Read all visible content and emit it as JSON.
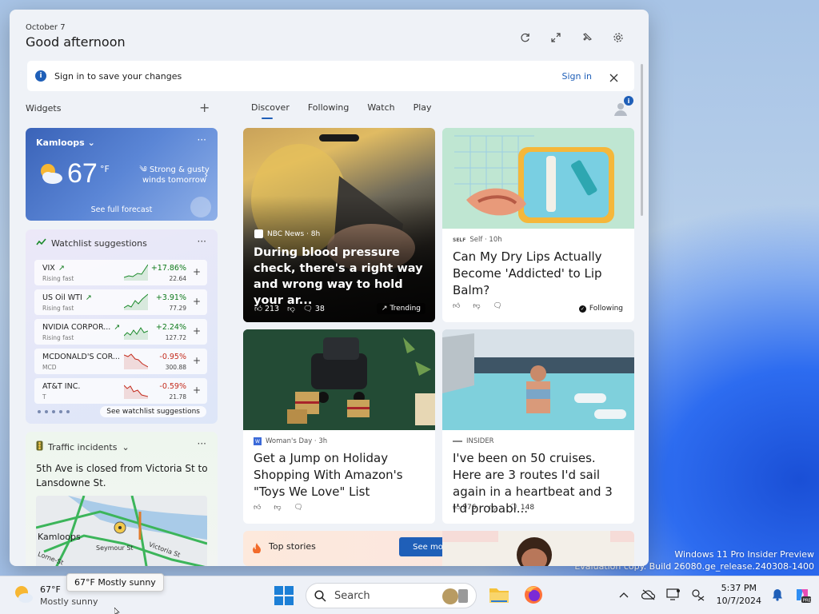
{
  "desktop": {
    "watermark_line1": "Windows 11 Pro Insider Preview",
    "watermark_line2": "Evaluation copy. Build 26080.ge_release.240308-1400"
  },
  "panel": {
    "date": "October 7",
    "greeting": "Good afternoon",
    "header_icons": [
      "refresh-icon",
      "expand-icon",
      "pin-icon",
      "settings-icon"
    ],
    "signin_bar": {
      "text": "Sign in to save your changes",
      "link": "Sign in"
    },
    "widgets_label": "Widgets",
    "weather": {
      "location": "Kamloops",
      "temp": "67",
      "unit": "°F",
      "note": "Strong & gusty winds tomorrow",
      "forecast_link": "See full forecast"
    },
    "watchlist": {
      "title": "Watchlist suggestions",
      "items": [
        {
          "name": "VIX",
          "sub": "Rising fast",
          "change": "+17.86%",
          "price": "22.64",
          "dir": "pos"
        },
        {
          "name": "US Oil WTI",
          "sub": "Rising fast",
          "change": "+3.91%",
          "price": "77.29",
          "dir": "pos"
        },
        {
          "name": "NVIDIA CORPOR...",
          "sub": "Rising fast",
          "change": "+2.24%",
          "price": "127.72",
          "dir": "pos"
        },
        {
          "name": "MCDONALD'S COR...",
          "sub": "MCD",
          "change": "-0.95%",
          "price": "300.88",
          "dir": "neg"
        },
        {
          "name": "AT&T INC.",
          "sub": "T",
          "change": "-0.59%",
          "price": "21.78",
          "dir": "neg"
        }
      ],
      "see_link": "See watchlist suggestions"
    },
    "traffic": {
      "title": "Traffic incidents",
      "desc": "5th Ave is closed from Victoria St to Lansdowne St.",
      "map_labels": [
        "Kamloops",
        "Seymour St",
        "Victoria St",
        "Lorne-St"
      ]
    },
    "tabs": [
      "Discover",
      "Following",
      "Watch",
      "Play"
    ],
    "cards": [
      {
        "source": "NBC News · 8h",
        "title": "During blood pressure check, there's a right way and wrong way to hold your ar...",
        "likes": "213",
        "comments": "38",
        "badge": "Trending"
      },
      {
        "source": "Self · 10h",
        "title": "Can My Dry Lips Actually Become 'Addicted' to Lip Balm?",
        "status": "Following"
      },
      {
        "source": "Woman's Day · 3h",
        "title": "Get a Jump on Holiday Shopping With Amazon's \"Toys We Love\" List"
      },
      {
        "source": "INSIDER",
        "title": "I've been on 50 cruises. Here are 3 routes I'd sail again in a heartbeat and 3 I'd probabl...",
        "likes": "976",
        "comments": "148"
      }
    ],
    "top_stories": {
      "label": "Top stories",
      "button": "See more"
    }
  },
  "taskbar": {
    "weather_temp": "67°F",
    "weather_cond": "Mostly sunny",
    "tooltip": "67°F Mostly sunny",
    "search_placeholder": "Search",
    "time": "5:37 PM",
    "date": "10/7/2024"
  },
  "colors": {
    "accent": "#1f5fb8",
    "positive": "#0e7a1a",
    "negative": "#c42b1c"
  }
}
